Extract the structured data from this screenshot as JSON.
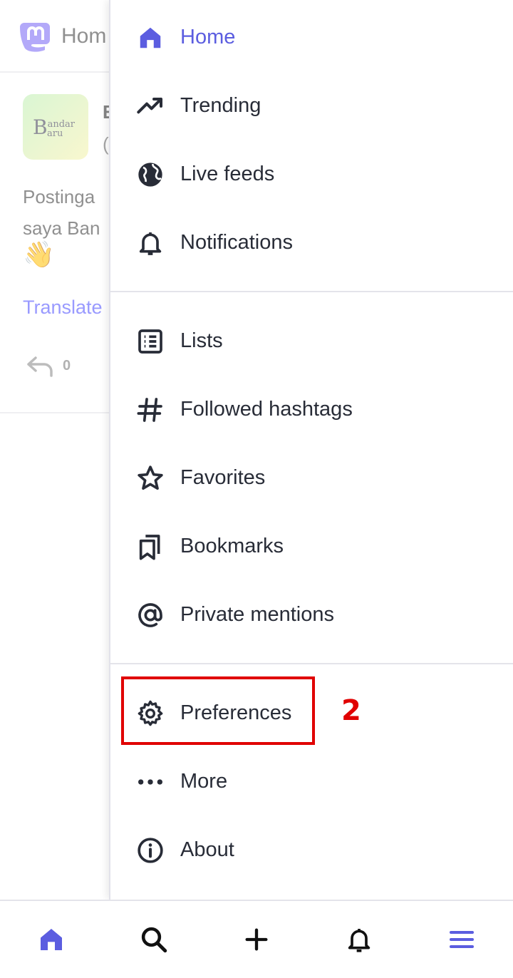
{
  "background": {
    "header_title": "Hom",
    "avatar_text_main": "B",
    "avatar_text_top": "andar",
    "avatar_text_bottom": "aru",
    "name_fragment": "E",
    "paren_fragment": "(",
    "post_line1": "Postinga",
    "post_line2": "saya Ban",
    "emoji": "👋",
    "translate_label": "Translate",
    "reply_count": "0"
  },
  "drawer": {
    "items": [
      {
        "label": "Home",
        "icon": "home-icon",
        "active": true
      },
      {
        "label": "Trending",
        "icon": "trending-icon"
      },
      {
        "label": "Live feeds",
        "icon": "globe-icon"
      },
      {
        "label": "Notifications",
        "icon": "bell-icon"
      },
      {
        "label": "Lists",
        "icon": "list-icon"
      },
      {
        "label": "Followed hashtags",
        "icon": "hashtag-icon"
      },
      {
        "label": "Favorites",
        "icon": "star-icon"
      },
      {
        "label": "Bookmarks",
        "icon": "bookmarks-icon"
      },
      {
        "label": "Private mentions",
        "icon": "at-icon"
      },
      {
        "label": "Preferences",
        "icon": "gear-icon"
      },
      {
        "label": "More",
        "icon": "ellipsis-icon"
      },
      {
        "label": "About",
        "icon": "info-icon"
      }
    ]
  },
  "annotation": {
    "step_number": "2"
  },
  "bottom_nav": [
    "home-icon",
    "search-icon",
    "plus-icon",
    "bell-icon",
    "menu-icon"
  ],
  "colors": {
    "accent": "#6364ff",
    "text": "#282c37",
    "highlight": "#e00000"
  }
}
